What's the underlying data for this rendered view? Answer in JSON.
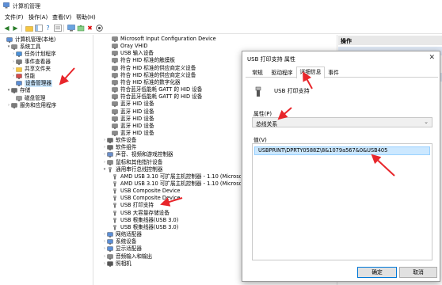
{
  "window": {
    "title": "计算机管理"
  },
  "menu": [
    "文件(F)",
    "操作(A)",
    "查看(V)",
    "帮助(H)"
  ],
  "left_tree": [
    {
      "label": "计算机管理(本地)",
      "icon": "computer-icon",
      "level": 0,
      "exp": ""
    },
    {
      "label": "系统工具",
      "icon": "tools-icon",
      "level": 1,
      "exp": "▾"
    },
    {
      "label": "任务计划程序",
      "icon": "clock-icon",
      "level": 2,
      "exp": "›"
    },
    {
      "label": "事件查看器",
      "icon": "event-icon",
      "level": 2,
      "exp": "›"
    },
    {
      "label": "共享文件夹",
      "icon": "folder-icon",
      "level": 2,
      "exp": "›"
    },
    {
      "label": "性能",
      "icon": "performance-icon",
      "level": 2,
      "exp": "›"
    },
    {
      "label": "设备管理器",
      "icon": "device-manager-icon",
      "level": 2,
      "exp": "",
      "selected": true
    },
    {
      "label": "存储",
      "icon": "storage-icon",
      "level": 1,
      "exp": "▾"
    },
    {
      "label": "磁盘管理",
      "icon": "disk-icon",
      "level": 2,
      "exp": ""
    },
    {
      "label": "服务和应用程序",
      "icon": "services-icon",
      "level": 1,
      "exp": "›"
    }
  ],
  "device_tree": [
    {
      "label": "Microsoft Input Configuration Device",
      "icon": "hid-icon",
      "level": 3,
      "exp": ""
    },
    {
      "label": "Oray VHID",
      "icon": "hid-icon",
      "level": 3,
      "exp": ""
    },
    {
      "label": "USB 输入设备",
      "icon": "hid-icon",
      "level": 3,
      "exp": ""
    },
    {
      "label": "符合 HID 标准的触摸板",
      "icon": "hid-icon",
      "level": 3,
      "exp": ""
    },
    {
      "label": "符合 HID 标准的供应商定义设备",
      "icon": "hid-icon",
      "level": 3,
      "exp": ""
    },
    {
      "label": "符合 HID 标准的供应商定义设备",
      "icon": "hid-icon",
      "level": 3,
      "exp": ""
    },
    {
      "label": "符合 HID 标准的数字化器",
      "icon": "hid-icon",
      "level": 3,
      "exp": ""
    },
    {
      "label": "符合蓝牙低能耗 GATT 的 HID 设备",
      "icon": "hid-icon",
      "level": 3,
      "exp": ""
    },
    {
      "label": "符合蓝牙低能耗 GATT 的 HID 设备",
      "icon": "hid-icon",
      "level": 3,
      "exp": ""
    },
    {
      "label": "蓝牙 HID 设备",
      "icon": "hid-icon",
      "level": 3,
      "exp": ""
    },
    {
      "label": "蓝牙 HID 设备",
      "icon": "hid-icon",
      "level": 3,
      "exp": ""
    },
    {
      "label": "蓝牙 HID 设备",
      "icon": "hid-icon",
      "level": 3,
      "exp": ""
    },
    {
      "label": "蓝牙 HID 设备",
      "icon": "hid-icon",
      "level": 3,
      "exp": ""
    },
    {
      "label": "蓝牙 HID 设备",
      "icon": "hid-icon",
      "level": 3,
      "exp": ""
    },
    {
      "label": "软件设备",
      "icon": "software-device-icon",
      "level": 2,
      "exp": "›"
    },
    {
      "label": "软件组件",
      "icon": "software-component-icon",
      "level": 2,
      "exp": "›"
    },
    {
      "label": "声音、视频和游戏控制器",
      "icon": "sound-icon",
      "level": 2,
      "exp": "›"
    },
    {
      "label": "鼠标和其他指针设备",
      "icon": "mouse-icon",
      "level": 2,
      "exp": "›"
    },
    {
      "label": "通用串行总线控制器",
      "icon": "usb-icon",
      "level": 2,
      "exp": "▾"
    },
    {
      "label": "AMD USB 3.10 可扩展主机控制器 - 1.10 (Microsoft)",
      "icon": "usb-icon",
      "level": 3,
      "exp": ""
    },
    {
      "label": "AMD USB 3.10 可扩展主机控制器 - 1.10 (Microsoft)",
      "icon": "usb-icon",
      "level": 3,
      "exp": ""
    },
    {
      "label": "USB Composite Device",
      "icon": "usb-icon",
      "level": 3,
      "exp": ""
    },
    {
      "label": "USB Composite Device",
      "icon": "usb-icon",
      "level": 3,
      "exp": ""
    },
    {
      "label": "USB 打印支持",
      "icon": "usb-icon",
      "level": 3,
      "exp": ""
    },
    {
      "label": "USB 大容量存储设备",
      "icon": "usb-icon",
      "level": 3,
      "exp": ""
    },
    {
      "label": "USB 根集线器(USB 3.0)",
      "icon": "usb-icon",
      "level": 3,
      "exp": ""
    },
    {
      "label": "USB 根集线器(USB 3.0)",
      "icon": "usb-icon",
      "level": 3,
      "exp": ""
    },
    {
      "label": "网络适配器",
      "icon": "network-icon",
      "level": 2,
      "exp": "›"
    },
    {
      "label": "系统设备",
      "icon": "system-icon",
      "level": 2,
      "exp": "›"
    },
    {
      "label": "显示适配器",
      "icon": "display-icon",
      "level": 2,
      "exp": "›"
    },
    {
      "label": "音频输入和输出",
      "icon": "audio-icon",
      "level": 2,
      "exp": "›"
    },
    {
      "label": "照相机",
      "icon": "camera-icon",
      "level": 2,
      "exp": "›"
    }
  ],
  "actions": {
    "header": "操作"
  },
  "dialog": {
    "title": "USB 打印支持 属性",
    "close": "✕",
    "tabs": [
      "常规",
      "驱动程序",
      "详细信息",
      "事件"
    ],
    "active_tab": 2,
    "device_name": "USB 打印支持",
    "property_label": "属性(P)",
    "property_value": "总线关系",
    "value_label": "值(V)",
    "value": "USBPRINT\\DPRTY0588Z\\8&1079a567&0&USB405",
    "ok": "确定",
    "cancel": "取消"
  },
  "colors": {
    "accent": "#0078d7",
    "selection": "#cce8ff",
    "arrow": "#e8262b"
  }
}
